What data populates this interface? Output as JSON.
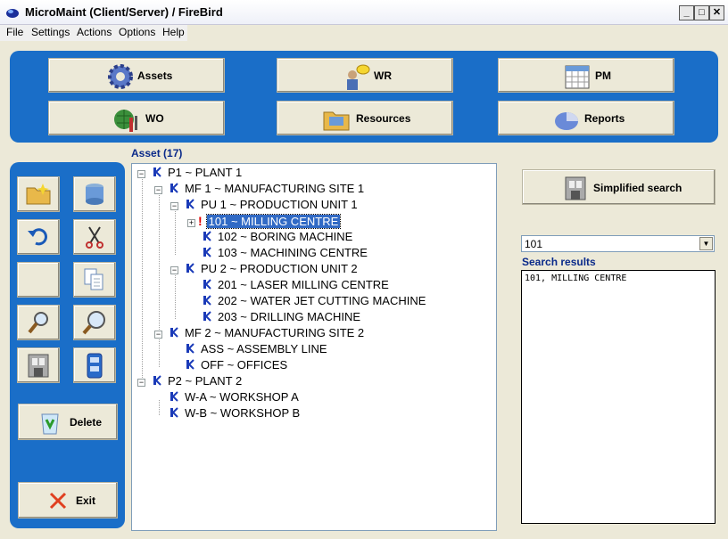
{
  "window": {
    "title": "MicroMaint (Client/Server) / FireBird"
  },
  "menu": [
    "File",
    "Settings",
    "Actions",
    "Options",
    "Help"
  ],
  "modules": [
    {
      "label": "Assets",
      "icon": "gear-icon"
    },
    {
      "label": "WR",
      "icon": "person-speech-icon"
    },
    {
      "label": "PM",
      "icon": "calendar-icon"
    },
    {
      "label": "WO",
      "icon": "globe-tools-icon"
    },
    {
      "label": "Resources",
      "icon": "folder-icon"
    },
    {
      "label": "Reports",
      "icon": "pie-chart-icon"
    }
  ],
  "toolbar": {
    "delete_label": "Delete",
    "exit_label": "Exit"
  },
  "tree": {
    "label": "Asset (17)",
    "nodes": [
      {
        "text": "P1 ~ PLANT 1"
      },
      {
        "text": "MF 1 ~ MANUFACTURING SITE 1"
      },
      {
        "text": "PU 1 ~ PRODUCTION UNIT 1"
      },
      {
        "text": "101 ~ MILLING CENTRE",
        "selected": true,
        "alert": true
      },
      {
        "text": "102 ~ BORING MACHINE"
      },
      {
        "text": "103 ~ MACHINING CENTRE"
      },
      {
        "text": "PU 2 ~ PRODUCTION UNIT 2"
      },
      {
        "text": "201 ~ LASER MILLING CENTRE"
      },
      {
        "text": "202 ~ WATER JET CUTTING MACHINE"
      },
      {
        "text": "203 ~ DRILLING MACHINE"
      },
      {
        "text": "MF 2 ~ MANUFACTURING SITE 2"
      },
      {
        "text": "ASS ~ ASSEMBLY LINE"
      },
      {
        "text": "OFF ~ OFFICES"
      },
      {
        "text": "P2 ~ PLANT 2"
      },
      {
        "text": "W-A ~ WORKSHOP  A"
      },
      {
        "text": "W-B ~ WORKSHOP  B"
      }
    ]
  },
  "search": {
    "button_label": "Simplified search",
    "query": "101",
    "results_label": "Search results",
    "results": [
      "101, MILLING CENTRE"
    ]
  },
  "colors": {
    "panel": "#1a6ec8",
    "selection": "#316ac5",
    "heading": "#0a2a8a"
  }
}
